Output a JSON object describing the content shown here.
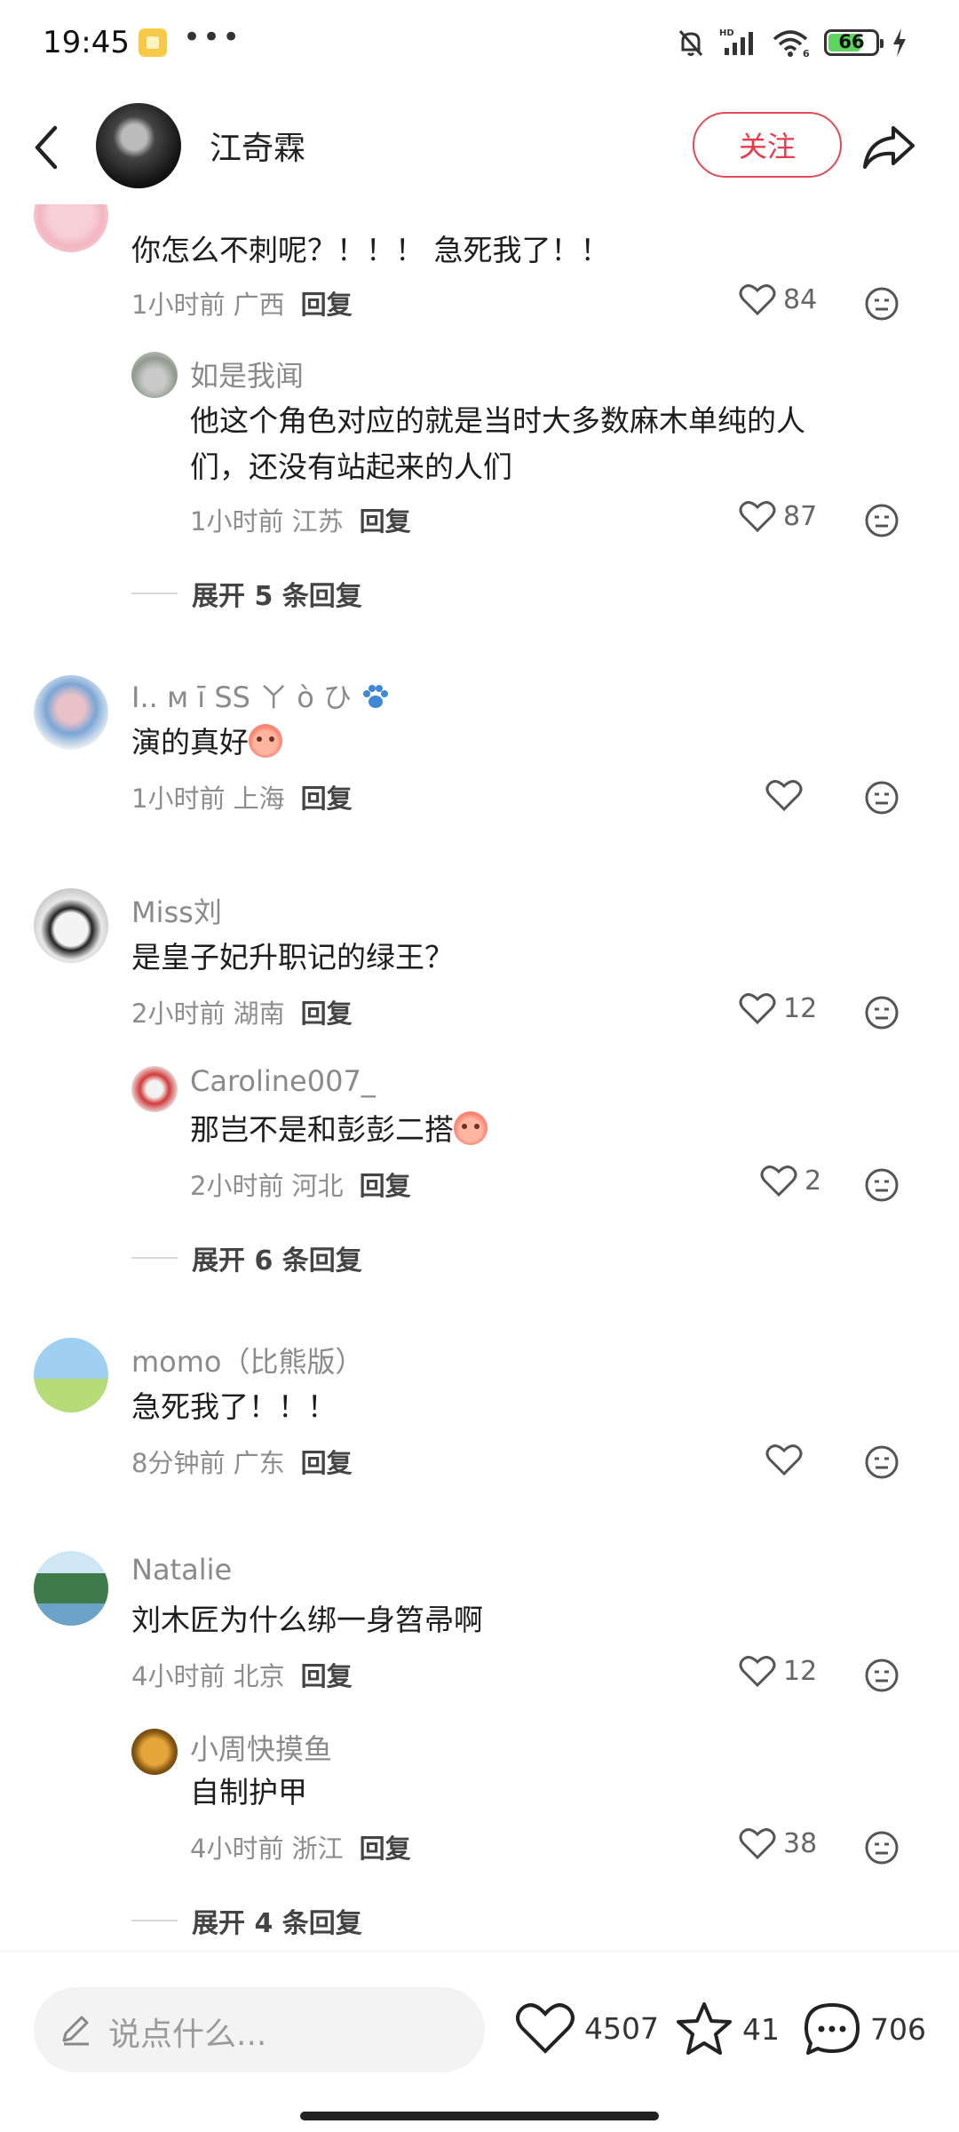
{
  "status_bar": {
    "time": "19:45",
    "dots": "•••",
    "battery": "66"
  },
  "header": {
    "name": "江奇霖",
    "follow_label": "关注"
  },
  "comments": [
    {
      "name": "",
      "text": "你怎么不刺呢？！！！ 急死我了！！",
      "meta": "1小时前  广西",
      "reply": "回复",
      "likes": "84",
      "replies": [
        {
          "name": "如是我闻",
          "text_line1": "他这个角色对应的就是当时大多数麻木单纯的人",
          "text_line2": "们，还没有站起来的人们",
          "meta": "1小时前  江苏",
          "reply": "回复",
          "likes": "87"
        }
      ],
      "expand": "展开 5 条回复"
    },
    {
      "name": "I.. ᴍ  ī SS  ㄚ ò ひ",
      "text": "演的真好",
      "meta": "1小时前  上海",
      "reply": "回复",
      "likes": ""
    },
    {
      "name": "Miss刘",
      "text": "是皇子妃升职记的绿王？",
      "meta": "2小时前  湖南",
      "reply": "回复",
      "likes": "12",
      "replies": [
        {
          "name": "Caroline007_",
          "text": "那岂不是和彭彭二搭",
          "meta": "2小时前  河北",
          "reply": "回复",
          "likes": "2"
        }
      ],
      "expand": "展开 6 条回复"
    },
    {
      "name": "momo（比熊版）",
      "text": "急死我了！！！",
      "meta": "8分钟前  广东",
      "reply": "回复",
      "likes": ""
    },
    {
      "name": "Natalie",
      "text": "刘木匠为什么绑一身笤帚啊",
      "meta": "4小时前  北京",
      "reply": "回复",
      "likes": "12",
      "replies": [
        {
          "name": "小周快摸鱼",
          "text": "自制护甲",
          "meta": "4小时前  浙江",
          "reply": "回复",
          "likes": "38"
        }
      ],
      "expand": "展开 4 条回复"
    }
  ],
  "bottom_bar": {
    "input_placeholder": "说点什么...",
    "likes": "4507",
    "stars": "41",
    "comments": "706"
  },
  "colors": {
    "accent": "#e83a48",
    "text_primary": "#1d1d1d",
    "text_secondary": "#8d8d8d"
  }
}
